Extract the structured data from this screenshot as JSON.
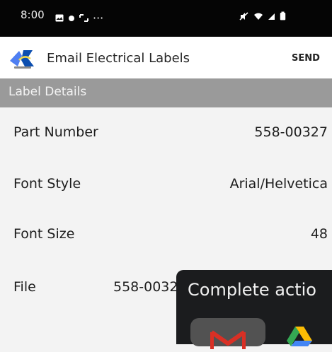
{
  "status_bar": {
    "time": "8:00",
    "more": "···",
    "icons_left": [
      "gallery-icon",
      "dot-icon",
      "screenshot-icon"
    ],
    "icons_right": [
      "mute-icon",
      "wifi-icon",
      "signal-icon",
      "battery-icon"
    ]
  },
  "app_bar": {
    "title": "Email Electrical Labels",
    "send_label": "SEND"
  },
  "section_header": "Label Details",
  "details": [
    {
      "label": "Part Number",
      "value": "558-00327"
    },
    {
      "label": "Font Style",
      "value": "Arial/Helvetica"
    },
    {
      "label": "Font Size",
      "value": "48"
    },
    {
      "label": "File",
      "value": "558-0032"
    }
  ],
  "dialog": {
    "title": "Complete actio",
    "apps": [
      {
        "icon": "gmail-icon"
      },
      {
        "icon": "google-drive-icon"
      }
    ]
  },
  "colors": {
    "status_bar": "#050505",
    "header": "#9a9a9a",
    "background": "#f3f3f3",
    "dialog": "#1b1c1e",
    "dialog_tile": "#525252"
  }
}
